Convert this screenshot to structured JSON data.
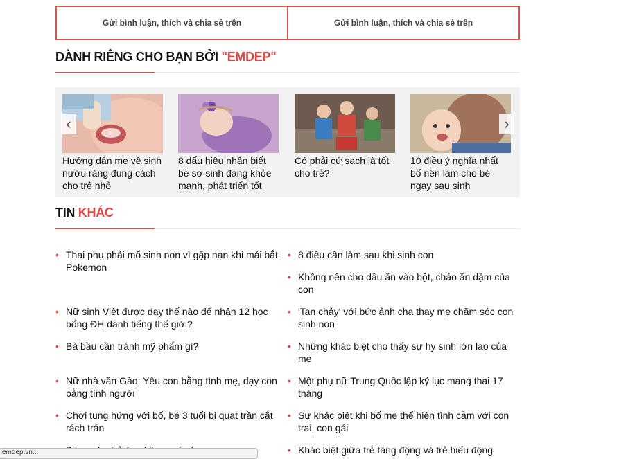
{
  "comment_bar": {
    "left_label": "Gửi bình luận, thích và chia sẻ trên",
    "right_label": "Gửi bình luận, thích và chia sẻ trên"
  },
  "recommend": {
    "title_main": "DÀNH RIÊNG CHO BẠN BỞI ",
    "title_accent": "\"EMDEP\"",
    "prev_icon": "chevron-left-icon",
    "next_icon": "chevron-right-icon",
    "cards": [
      {
        "title": "Hướng dẫn mẹ vệ sinh nướu răng đúng cách cho trẻ nhỏ"
      },
      {
        "title": "8 dấu hiệu nhận biết bé sơ sinh đang khỏe mạnh, phát triển tốt"
      },
      {
        "title": "Có phải cứ sạch là tốt cho trẻ?"
      },
      {
        "title": "10 điều ý nghĩa nhất bố nên làm cho bé ngay sau sinh"
      }
    ]
  },
  "other_news": {
    "title_main": "TIN ",
    "title_accent": "KHÁC",
    "left": [
      "Thai phụ phải mổ sinh non vì gặp nạn khi mải bắt Pokemon",
      "Nữ sinh Việt được dạy thế nào để nhận 12 học bổng ĐH danh tiếng thế giới?",
      "Bà bầu cần tránh mỹ phẩm gì?",
      "Nữ nhà văn Gào: Yêu con bằng tình mẹ, dạy con bằng tình người",
      "Chơi tung hứng với bố, bé 3 tuổi bị quạt trần cắt rách trán",
      "Đừng cho trẻ ăn những món lạ..."
    ],
    "right": [
      "8 điều cần làm sau khi sinh con",
      "Không nên cho dầu ăn vào bột, cháo ăn dặm của con",
      "'Tan chảy' với bức ảnh cha thay mẹ chăm sóc con sinh non",
      "Những khác biệt cho thấy sự hy sinh lớn lao của mẹ",
      "Một phụ nữ Trung Quốc lập kỷ lục mang thai 17 tháng",
      "Sự khác biệt khi bố mẹ thể hiện tình cảm với con trai, con gái",
      "Khác biệt giữa trẻ tăng động và trẻ hiếu động"
    ]
  },
  "status_chip": "emdep.vn..."
}
